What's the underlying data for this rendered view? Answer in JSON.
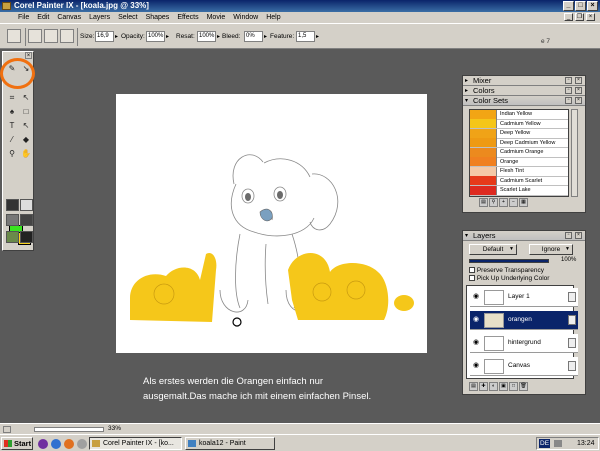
{
  "window": {
    "title": "Corel Painter IX - [koala.jpg @ 33%]"
  },
  "menu": [
    "File",
    "Edit",
    "Canvas",
    "Layers",
    "Select",
    "Shapes",
    "Effects",
    "Movie",
    "Window",
    "Help"
  ],
  "propbar": {
    "size_label": "Size:",
    "size_value": "16,9",
    "opacity_label": "Opacity:",
    "opacity_value": "100%",
    "resat_label": "Resat:",
    "resat_value": "100%",
    "bleed_label": "Bleed:",
    "bleed_value": "0%",
    "feature_label": "Feature:",
    "feature_value": "1,5",
    "right_text": "e 7"
  },
  "caption": {
    "line1": "Als erstes werden die Orangen einfach nur",
    "line2": "ausgemalt.Das mache ich mit einem einfachen Pinsel."
  },
  "panels": {
    "mixer": "Mixer",
    "colors": "Colors",
    "color_sets": "Color Sets",
    "layers": "Layers"
  },
  "color_sets": [
    {
      "name": "Indian Yellow",
      "color": "#f2a514"
    },
    {
      "name": "Cadmium Yellow",
      "color": "#f5c618"
    },
    {
      "name": "Deep Yellow",
      "color": "#f0a317"
    },
    {
      "name": "Deep Cadmium Yellow",
      "color": "#ee9a13"
    },
    {
      "name": "Cadmium Orange",
      "color": "#ec8a1e"
    },
    {
      "name": "Orange",
      "color": "#f08020"
    },
    {
      "name": "Flesh Tint",
      "color": "#f5c9a6"
    },
    {
      "name": "Cadmium Scarlet",
      "color": "#e63a1a"
    },
    {
      "name": "Scarlet Lake",
      "color": "#dd2a20"
    }
  ],
  "layers_panel": {
    "composite": "Default",
    "depth": "Ignore",
    "opacity": "100%",
    "preserve": "Preserve Transparency",
    "pickup": "Pick Up Underlying Color",
    "items": [
      "Layer 1",
      "orangen",
      "hintergrund",
      "Canvas"
    ]
  },
  "status": {
    "zoom": "33%"
  },
  "taskbar": {
    "start": "Start",
    "buttons": [
      "Corel Painter IX - [ko...",
      "koala12 - Paint"
    ],
    "lang": "DE",
    "time": "13:24"
  },
  "colors": {
    "fg": "#39e51f",
    "bg": "#f7d21f",
    "orange_paint": "#f5c71a",
    "highlight": "#f07010"
  }
}
